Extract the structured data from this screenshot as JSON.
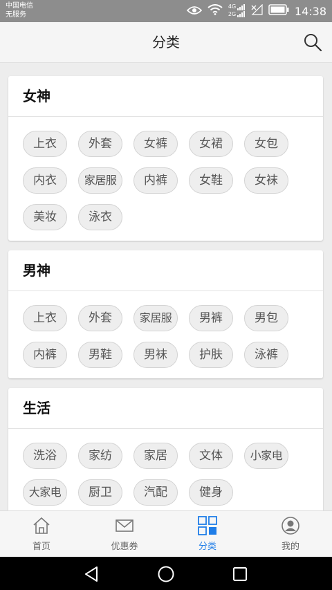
{
  "status_bar": {
    "carrier_line1": "中国电信",
    "carrier_line2": "无服务",
    "network_label_top": "4G",
    "network_label_bottom": "2G",
    "time": "14:38"
  },
  "header": {
    "title": "分类"
  },
  "sections": [
    {
      "title": "女神",
      "tags": [
        "上衣",
        "外套",
        "女裤",
        "女裙",
        "女包",
        "内衣",
        "家居服",
        "内裤",
        "女鞋",
        "女袜",
        "美妆",
        "泳衣"
      ]
    },
    {
      "title": "男神",
      "tags": [
        "上衣",
        "外套",
        "家居服",
        "男裤",
        "男包",
        "内裤",
        "男鞋",
        "男袜",
        "护肤",
        "泳裤"
      ]
    },
    {
      "title": "生活",
      "tags": [
        "洗浴",
        "家纺",
        "家居",
        "文体",
        "小家电",
        "大家电",
        "厨卫",
        "汽配",
        "健身"
      ]
    }
  ],
  "bottom_nav": [
    {
      "label": "首页",
      "icon": "home-icon",
      "active": false
    },
    {
      "label": "优惠券",
      "icon": "coupon-envelope-icon",
      "active": false
    },
    {
      "label": "分类",
      "icon": "category-grid-icon",
      "active": true
    },
    {
      "label": "我的",
      "icon": "profile-icon",
      "active": false
    }
  ],
  "colors": {
    "accent": "#1f7de8",
    "status_bar": "#8d8d8d",
    "background": "#ededed"
  }
}
